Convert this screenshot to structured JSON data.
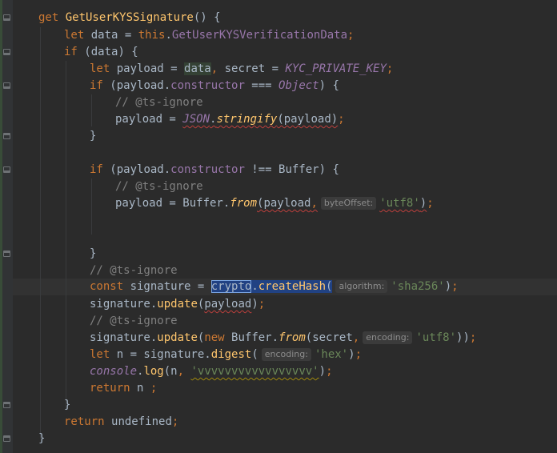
{
  "editor": {
    "lines": [
      {
        "id": "l1",
        "parts": [
          [
            "kw",
            "get "
          ],
          [
            "fn",
            "GetUserKYSSignature"
          ],
          [
            "",
            "() {"
          ]
        ]
      },
      {
        "id": "l2",
        "parts": [
          [
            "kw",
            "let "
          ],
          [
            "",
            "data = "
          ],
          [
            "kw",
            "this"
          ],
          [
            "",
            "."
          ],
          [
            "prop",
            "GetUserKYSVerificationData"
          ],
          [
            "kw",
            ";"
          ]
        ]
      },
      {
        "id": "l3",
        "parts": [
          [
            "kw",
            "if "
          ],
          [
            "",
            "(data) {"
          ]
        ]
      },
      {
        "id": "l4",
        "parts": [
          [
            "kw",
            "let "
          ],
          [
            "",
            "payload = "
          ],
          [
            "ident",
            "data"
          ],
          [
            "kw",
            ", "
          ],
          [
            "",
            "secret = "
          ],
          [
            "const-i",
            "KYC_PRIVATE_KEY"
          ],
          [
            "kw",
            ";"
          ]
        ]
      },
      {
        "id": "l5",
        "parts": [
          [
            "kw",
            "if "
          ],
          [
            "",
            "(payload."
          ],
          [
            "prop",
            "constructor"
          ],
          [
            "",
            " === "
          ],
          [
            "cls-i",
            "Object"
          ],
          [
            "",
            ") {"
          ]
        ]
      },
      {
        "id": "l6",
        "parts": [
          [
            "cmt",
            "// @ts-ignore"
          ]
        ]
      },
      {
        "id": "l7",
        "parts": [
          [
            "",
            "payload = "
          ],
          [
            "squig-open",
            ""
          ],
          [
            "cls-i",
            "JSON"
          ],
          [
            "",
            "."
          ],
          [
            "static-i",
            "stringify"
          ],
          [
            "",
            "(payload)"
          ],
          [
            "squig-close",
            ""
          ],
          [
            "kw",
            ";"
          ]
        ]
      },
      {
        "id": "l8",
        "parts": [
          [
            "",
            "}"
          ]
        ]
      },
      {
        "id": "l9",
        "parts": []
      },
      {
        "id": "l10",
        "parts": [
          [
            "kw",
            "if "
          ],
          [
            "",
            "(payload."
          ],
          [
            "prop",
            "constructor"
          ],
          [
            "",
            " !== Buffer) {"
          ]
        ]
      },
      {
        "id": "l11",
        "parts": [
          [
            "cmt",
            "// @ts-ignore"
          ]
        ]
      },
      {
        "id": "l12",
        "parts": [
          [
            "",
            "payload = Buffer."
          ],
          [
            "static-i",
            "from"
          ],
          [
            "squig-open",
            ""
          ],
          [
            "",
            "(payload"
          ],
          [
            "kw",
            ","
          ],
          [
            "hint",
            "byteOffset:"
          ],
          [
            "str",
            "'utf8'"
          ],
          [
            "",
            ")"
          ],
          [
            "squig-close",
            ""
          ],
          [
            "kw",
            ";"
          ]
        ]
      },
      {
        "id": "l13",
        "parts": []
      },
      {
        "id": "l14",
        "parts": []
      },
      {
        "id": "l15",
        "parts": [
          [
            "",
            "}"
          ]
        ]
      },
      {
        "id": "l16",
        "parts": [
          [
            "cmt",
            "// @ts-ignore"
          ]
        ]
      },
      {
        "id": "l17",
        "parts": [
          [
            "kw",
            "const "
          ],
          [
            "",
            "signature = "
          ],
          [
            "sel-word",
            "crypto"
          ],
          [
            "sel-rest",
            "."
          ],
          [
            "sel-fn",
            "createHash"
          ],
          [
            "sel-rest",
            "("
          ],
          [
            "hint",
            "algorithm:"
          ],
          [
            "str",
            "'sha256'"
          ],
          [
            "",
            ")"
          ],
          [
            "kw",
            ";"
          ]
        ]
      },
      {
        "id": "l18",
        "parts": [
          [
            "",
            "signature."
          ],
          [
            "fn",
            "update"
          ],
          [
            "",
            "("
          ],
          [
            "squig",
            "payload"
          ],
          [
            "",
            ")"
          ],
          [
            "kw",
            ";"
          ]
        ]
      },
      {
        "id": "l19",
        "parts": [
          [
            "cmt",
            "// @ts-ignore"
          ]
        ]
      },
      {
        "id": "l20",
        "parts": [
          [
            "",
            "signature."
          ],
          [
            "fn",
            "update"
          ],
          [
            "",
            "("
          ],
          [
            "kw",
            "new "
          ],
          [
            "",
            "Buffer."
          ],
          [
            "static-i",
            "from"
          ],
          [
            "",
            "(secret"
          ],
          [
            "kw",
            ","
          ],
          [
            "hint",
            "encoding:"
          ],
          [
            "str",
            "'utf8'"
          ],
          [
            "",
            "))"
          ],
          [
            "kw",
            ";"
          ]
        ]
      },
      {
        "id": "l21",
        "parts": [
          [
            "kw",
            "let "
          ],
          [
            "",
            "n = signature."
          ],
          [
            "fn",
            "digest"
          ],
          [
            "",
            "("
          ],
          [
            "hint",
            "encoding:"
          ],
          [
            "str",
            "'hex'"
          ],
          [
            "",
            ")"
          ],
          [
            "kw",
            ";"
          ]
        ]
      },
      {
        "id": "l22",
        "parts": [
          [
            "const-i",
            "console"
          ],
          [
            "",
            "."
          ],
          [
            "fn",
            "log"
          ],
          [
            "",
            "(n"
          ],
          [
            "kw",
            ", "
          ],
          [
            "squigy-str",
            "'vvvvvvvvvvvvvvvvv'"
          ],
          [
            "",
            ")"
          ],
          [
            "kw",
            ";"
          ]
        ]
      },
      {
        "id": "l23",
        "parts": [
          [
            "kw",
            "return "
          ],
          [
            "",
            "n "
          ],
          [
            "kw",
            ";"
          ]
        ]
      },
      {
        "id": "l24",
        "parts": [
          [
            "",
            "}"
          ]
        ]
      },
      {
        "id": "l25",
        "parts": [
          [
            "kw",
            "return "
          ],
          [
            "",
            "undefined"
          ],
          [
            "kw",
            ";"
          ]
        ]
      },
      {
        "id": "l26",
        "parts": [
          [
            "",
            "}"
          ]
        ]
      }
    ]
  }
}
